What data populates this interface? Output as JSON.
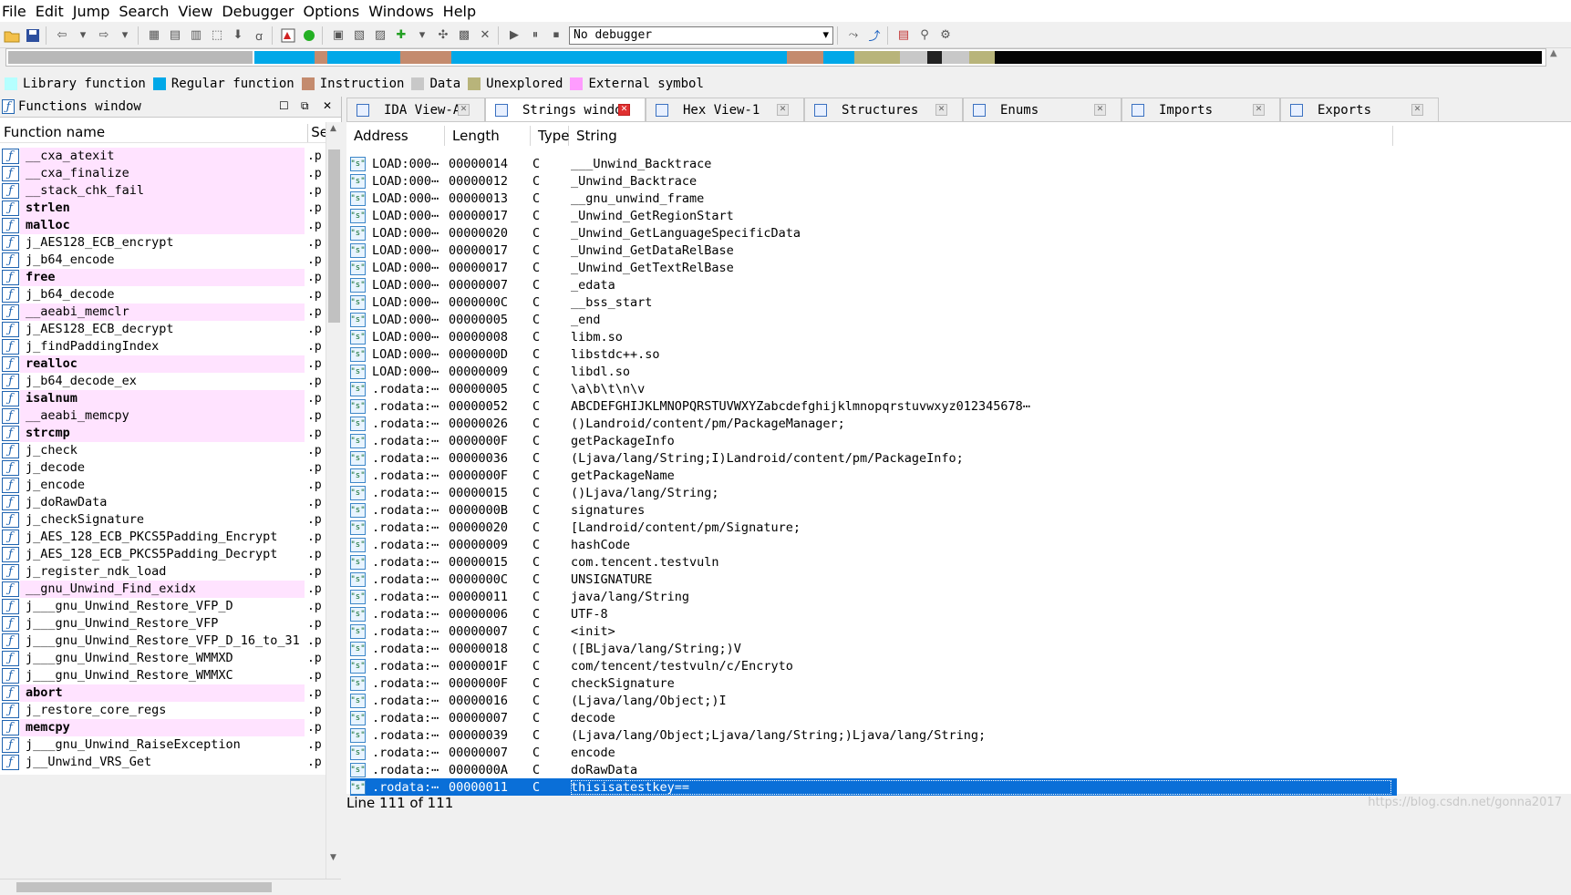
{
  "menu": [
    "File",
    "Edit",
    "Jump",
    "Search",
    "View",
    "Debugger",
    "Options",
    "Windows",
    "Help"
  ],
  "toolbar": {
    "debugger_value": "No debugger"
  },
  "legend": [
    {
      "label": "Library function",
      "color": "#b5ffff"
    },
    {
      "label": "Regular function",
      "color": "#00a8e8"
    },
    {
      "label": "Instruction",
      "color": "#c48b6e"
    },
    {
      "label": "Data",
      "color": "#c8c8c8"
    },
    {
      "label": "Unexplored",
      "color": "#b8b47a"
    },
    {
      "label": "External symbol",
      "color": "#ff9cff"
    }
  ],
  "functions_window": {
    "title": "Functions window",
    "col_name": "Function name",
    "col_seg": "Se",
    "items": [
      {
        "name": "__cxa_atexit",
        "seg": ".p",
        "pink": true,
        "bold": false
      },
      {
        "name": "__cxa_finalize",
        "seg": ".p",
        "pink": true,
        "bold": false
      },
      {
        "name": "__stack_chk_fail",
        "seg": ".p",
        "pink": true,
        "bold": false
      },
      {
        "name": "strlen",
        "seg": ".p",
        "pink": true,
        "bold": true
      },
      {
        "name": "malloc",
        "seg": ".p",
        "pink": true,
        "bold": true
      },
      {
        "name": "j_AES128_ECB_encrypt",
        "seg": ".p",
        "pink": false,
        "bold": false
      },
      {
        "name": "j_b64_encode",
        "seg": ".p",
        "pink": false,
        "bold": false
      },
      {
        "name": "free",
        "seg": ".p",
        "pink": true,
        "bold": true
      },
      {
        "name": "j_b64_decode",
        "seg": ".p",
        "pink": false,
        "bold": false
      },
      {
        "name": "__aeabi_memclr",
        "seg": ".p",
        "pink": true,
        "bold": false
      },
      {
        "name": "j_AES128_ECB_decrypt",
        "seg": ".p",
        "pink": false,
        "bold": false
      },
      {
        "name": "j_findPaddingIndex",
        "seg": ".p",
        "pink": false,
        "bold": false
      },
      {
        "name": "realloc",
        "seg": ".p",
        "pink": true,
        "bold": true
      },
      {
        "name": "j_b64_decode_ex",
        "seg": ".p",
        "pink": false,
        "bold": false
      },
      {
        "name": "isalnum",
        "seg": ".p",
        "pink": true,
        "bold": true
      },
      {
        "name": "__aeabi_memcpy",
        "seg": ".p",
        "pink": true,
        "bold": false
      },
      {
        "name": "strcmp",
        "seg": ".p",
        "pink": true,
        "bold": true
      },
      {
        "name": "j_check",
        "seg": ".p",
        "pink": false,
        "bold": false
      },
      {
        "name": "j_decode",
        "seg": ".p",
        "pink": false,
        "bold": false
      },
      {
        "name": "j_encode",
        "seg": ".p",
        "pink": false,
        "bold": false
      },
      {
        "name": "j_doRawData",
        "seg": ".p",
        "pink": false,
        "bold": false
      },
      {
        "name": "j_checkSignature",
        "seg": ".p",
        "pink": false,
        "bold": false
      },
      {
        "name": "j_AES_128_ECB_PKCS5Padding_Encrypt",
        "seg": ".p",
        "pink": false,
        "bold": false
      },
      {
        "name": "j_AES_128_ECB_PKCS5Padding_Decrypt",
        "seg": ".p",
        "pink": false,
        "bold": false
      },
      {
        "name": "j_register_ndk_load",
        "seg": ".p",
        "pink": false,
        "bold": false
      },
      {
        "name": "__gnu_Unwind_Find_exidx",
        "seg": ".p",
        "pink": true,
        "bold": false
      },
      {
        "name": "j___gnu_Unwind_Restore_VFP_D",
        "seg": ".p",
        "pink": false,
        "bold": false
      },
      {
        "name": "j___gnu_Unwind_Restore_VFP",
        "seg": ".p",
        "pink": false,
        "bold": false
      },
      {
        "name": "j___gnu_Unwind_Restore_VFP_D_16_to_31",
        "seg": ".p",
        "pink": false,
        "bold": false
      },
      {
        "name": "j___gnu_Unwind_Restore_WMMXD",
        "seg": ".p",
        "pink": false,
        "bold": false
      },
      {
        "name": "j___gnu_Unwind_Restore_WMMXC",
        "seg": ".p",
        "pink": false,
        "bold": false
      },
      {
        "name": "abort",
        "seg": ".p",
        "pink": true,
        "bold": true
      },
      {
        "name": "j_restore_core_regs",
        "seg": ".p",
        "pink": false,
        "bold": false
      },
      {
        "name": "memcpy",
        "seg": ".p",
        "pink": true,
        "bold": true
      },
      {
        "name": "j___gnu_Unwind_RaiseException",
        "seg": ".p",
        "pink": false,
        "bold": false
      },
      {
        "name": "j__Unwind_VRS_Get",
        "seg": ".p",
        "pink": false,
        "bold": false
      }
    ]
  },
  "tabs": [
    {
      "label": "IDA View-A",
      "active": false
    },
    {
      "label": "Strings window",
      "active": true
    },
    {
      "label": "Hex View-1",
      "active": false
    },
    {
      "label": "Structures",
      "active": false
    },
    {
      "label": "Enums",
      "active": false
    },
    {
      "label": "Imports",
      "active": false
    },
    {
      "label": "Exports",
      "active": false
    }
  ],
  "strings_window": {
    "columns": {
      "address": "Address",
      "length": "Length",
      "type": "Type",
      "string": "String"
    },
    "rows": [
      {
        "addr": "LOAD:000⋯",
        "len": "00000014",
        "type": "C",
        "str": "___Unwind_Backtrace"
      },
      {
        "addr": "LOAD:000⋯",
        "len": "00000012",
        "type": "C",
        "str": "_Unwind_Backtrace"
      },
      {
        "addr": "LOAD:000⋯",
        "len": "00000013",
        "type": "C",
        "str": "__gnu_unwind_frame"
      },
      {
        "addr": "LOAD:000⋯",
        "len": "00000017",
        "type": "C",
        "str": "_Unwind_GetRegionStart"
      },
      {
        "addr": "LOAD:000⋯",
        "len": "00000020",
        "type": "C",
        "str": "_Unwind_GetLanguageSpecificData"
      },
      {
        "addr": "LOAD:000⋯",
        "len": "00000017",
        "type": "C",
        "str": "_Unwind_GetDataRelBase"
      },
      {
        "addr": "LOAD:000⋯",
        "len": "00000017",
        "type": "C",
        "str": "_Unwind_GetTextRelBase"
      },
      {
        "addr": "LOAD:000⋯",
        "len": "00000007",
        "type": "C",
        "str": "_edata"
      },
      {
        "addr": "LOAD:000⋯",
        "len": "0000000C",
        "type": "C",
        "str": "__bss_start"
      },
      {
        "addr": "LOAD:000⋯",
        "len": "00000005",
        "type": "C",
        "str": "_end"
      },
      {
        "addr": "LOAD:000⋯",
        "len": "00000008",
        "type": "C",
        "str": "libm.so"
      },
      {
        "addr": "LOAD:000⋯",
        "len": "0000000D",
        "type": "C",
        "str": "libstdc++.so"
      },
      {
        "addr": "LOAD:000⋯",
        "len": "00000009",
        "type": "C",
        "str": "libdl.so"
      },
      {
        "addr": ".rodata:⋯",
        "len": "00000005",
        "type": "C",
        "str": "\\a\\b\\t\\n\\v"
      },
      {
        "addr": ".rodata:⋯",
        "len": "00000052",
        "type": "C",
        "str": "ABCDEFGHIJKLMNOPQRSTUVWXYZabcdefghijklmnopqrstuvwxyz012345678⋯"
      },
      {
        "addr": ".rodata:⋯",
        "len": "00000026",
        "type": "C",
        "str": "()Landroid/content/pm/PackageManager;"
      },
      {
        "addr": ".rodata:⋯",
        "len": "0000000F",
        "type": "C",
        "str": "getPackageInfo"
      },
      {
        "addr": ".rodata:⋯",
        "len": "00000036",
        "type": "C",
        "str": "(Ljava/lang/String;I)Landroid/content/pm/PackageInfo;"
      },
      {
        "addr": ".rodata:⋯",
        "len": "0000000F",
        "type": "C",
        "str": "getPackageName"
      },
      {
        "addr": ".rodata:⋯",
        "len": "00000015",
        "type": "C",
        "str": "()Ljava/lang/String;"
      },
      {
        "addr": ".rodata:⋯",
        "len": "0000000B",
        "type": "C",
        "str": "signatures"
      },
      {
        "addr": ".rodata:⋯",
        "len": "00000020",
        "type": "C",
        "str": "[Landroid/content/pm/Signature;"
      },
      {
        "addr": ".rodata:⋯",
        "len": "00000009",
        "type": "C",
        "str": "hashCode"
      },
      {
        "addr": ".rodata:⋯",
        "len": "00000015",
        "type": "C",
        "str": "com.tencent.testvuln"
      },
      {
        "addr": ".rodata:⋯",
        "len": "0000000C",
        "type": "C",
        "str": "UNSIGNATURE"
      },
      {
        "addr": ".rodata:⋯",
        "len": "00000011",
        "type": "C",
        "str": "java/lang/String"
      },
      {
        "addr": ".rodata:⋯",
        "len": "00000006",
        "type": "C",
        "str": "UTF-8"
      },
      {
        "addr": ".rodata:⋯",
        "len": "00000007",
        "type": "C",
        "str": "<init>"
      },
      {
        "addr": ".rodata:⋯",
        "len": "00000018",
        "type": "C",
        "str": "([BLjava/lang/String;)V"
      },
      {
        "addr": ".rodata:⋯",
        "len": "0000001F",
        "type": "C",
        "str": "com/tencent/testvuln/c/Encryto"
      },
      {
        "addr": ".rodata:⋯",
        "len": "0000000F",
        "type": "C",
        "str": "checkSignature"
      },
      {
        "addr": ".rodata:⋯",
        "len": "00000016",
        "type": "C",
        "str": "(Ljava/lang/Object;)I"
      },
      {
        "addr": ".rodata:⋯",
        "len": "00000007",
        "type": "C",
        "str": "decode"
      },
      {
        "addr": ".rodata:⋯",
        "len": "00000039",
        "type": "C",
        "str": "(Ljava/lang/Object;Ljava/lang/String;)Ljava/lang/String;"
      },
      {
        "addr": ".rodata:⋯",
        "len": "00000007",
        "type": "C",
        "str": "encode"
      },
      {
        "addr": ".rodata:⋯",
        "len": "0000000A",
        "type": "C",
        "str": "doRawData"
      },
      {
        "addr": ".rodata:⋯",
        "len": "00000011",
        "type": "C",
        "str": "thisisatestkey==",
        "selected": true
      }
    ]
  },
  "status": {
    "line": "Line 111 of 111"
  },
  "watermark": "https://blog.csdn.net/gonna2017"
}
